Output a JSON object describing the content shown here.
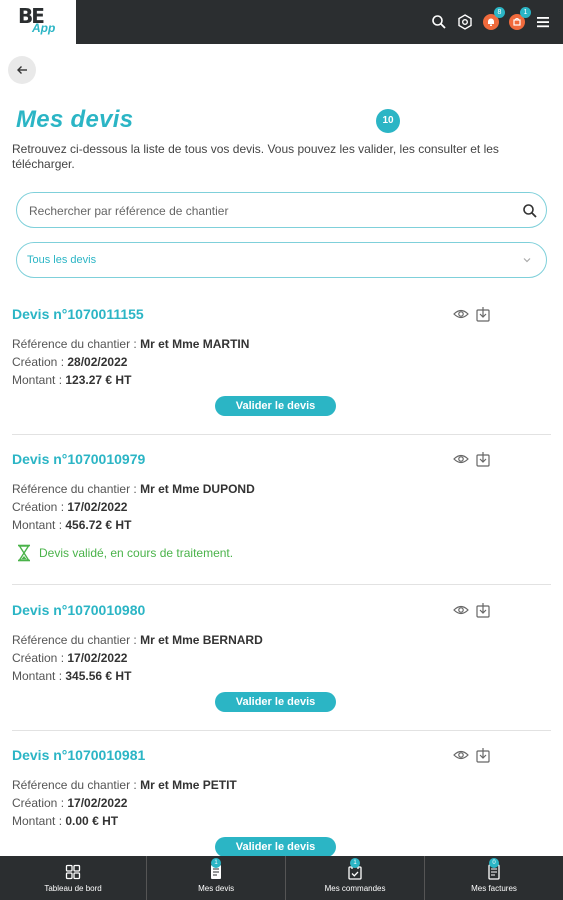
{
  "logo": {
    "mark": "BE",
    "app": "App"
  },
  "topbar": {
    "icons": [
      "search-icon",
      "settings-icon",
      "bell-icon",
      "cart-icon",
      "menu-icon"
    ],
    "badges": {
      "bell": "8",
      "cart": "1"
    }
  },
  "page": {
    "title": "Mes devis",
    "count": "10",
    "intro": "Retrouvez ci-dessous la liste de tous vos devis. Vous pouvez les valider, les consulter et les télécharger."
  },
  "search": {
    "placeholder": "Rechercher par référence de chantier",
    "value": ""
  },
  "filter": {
    "selected": "Tous les devis"
  },
  "labels": {
    "reference": "Référence du chantier : ",
    "creation": "Création : ",
    "montant": "Montant : ",
    "valider": "Valider le devis"
  },
  "devis": [
    {
      "title": "Devis n°1070011155",
      "reference": "Mr et Mme MARTIN",
      "creation": "28/02/2022",
      "montant": "123.27 € HT",
      "action": "valider"
    },
    {
      "title": "Devis n°1070010979",
      "reference": "Mr et Mme DUPOND",
      "creation": "17/02/2022",
      "montant": "456.72 € HT",
      "status": "Devis validé, en cours de traitement."
    },
    {
      "title": "Devis n°1070010980",
      "reference": "Mr et Mme BERNARD",
      "creation": "17/02/2022",
      "montant": "345.56 € HT",
      "action": "valider"
    },
    {
      "title": "Devis n°1070010981",
      "reference": "Mr et Mme PETIT",
      "creation": "17/02/2022",
      "montant": "0.00 € HT",
      "action": "valider"
    }
  ],
  "bottom_nav": [
    {
      "label": "Tableau de bord",
      "icon": "dashboard-icon"
    },
    {
      "label": "Mes devis",
      "icon": "quote-icon",
      "badge": "1"
    },
    {
      "label": "Mes commandes",
      "icon": "orders-icon",
      "badge": "1"
    },
    {
      "label": "Mes factures",
      "icon": "invoice-icon",
      "badge": "0"
    }
  ],
  "colors": {
    "accent": "#2bb5c5",
    "dark": "#2b2e30",
    "notif": "#f06a3c",
    "success": "#4ab34a"
  }
}
